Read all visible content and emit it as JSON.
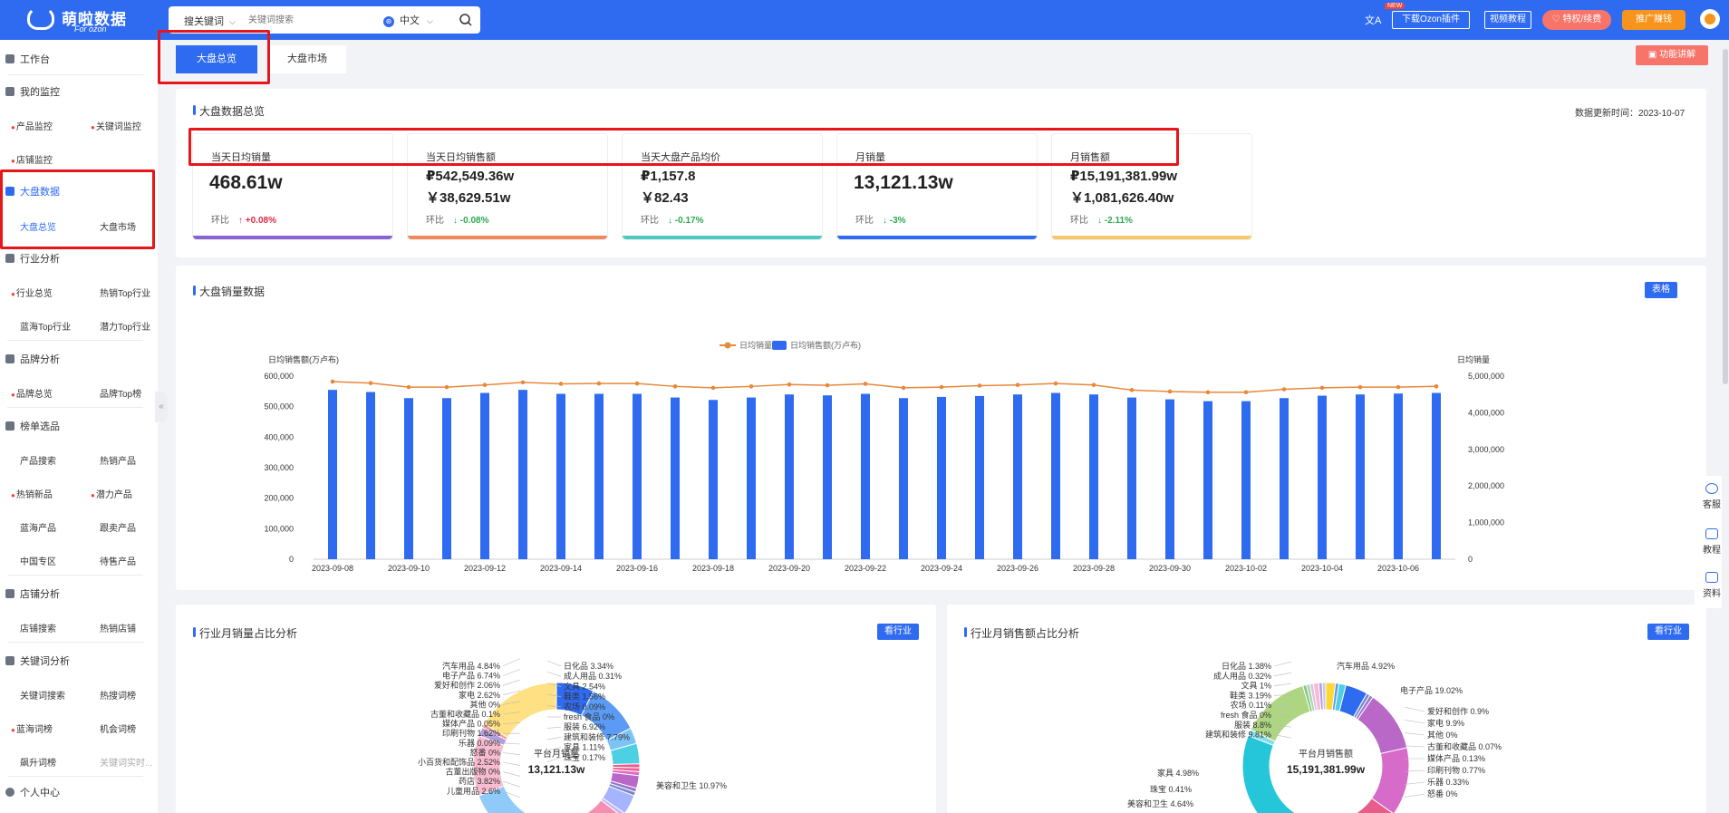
{
  "brand": {
    "name": "萌啦数据",
    "sub": "For ozon"
  },
  "search": {
    "type": "搜关键词",
    "placeholder": "关键词搜索",
    "lang": "中文"
  },
  "header": {
    "translate": "文A",
    "new_tag": "NEW",
    "download": "下载Ozon插件",
    "video": "视频教程",
    "vip": "特权/续费",
    "promo": "推广赚钱"
  },
  "sidebar": {
    "workbench": "工作台",
    "monitor": "我的监控",
    "monitor_items": [
      "产品监控",
      "关键词监控",
      "店铺监控"
    ],
    "market": "大盘数据",
    "market_items": [
      "大盘总览",
      "大盘市场"
    ],
    "industry": "行业分析",
    "industry_items": [
      "行业总览",
      "热销Top行业",
      "蓝海Top行业",
      "潜力Top行业"
    ],
    "brand": "品牌分析",
    "brand_items": [
      "品牌总览",
      "品牌Top榜"
    ],
    "selection": "榜单选品",
    "selection_items": [
      "产品搜索",
      "热销产品",
      "热销新品",
      "潜力产品",
      "蓝海产品",
      "跟卖产品",
      "中国专区",
      "待售产品"
    ],
    "shop": "店铺分析",
    "shop_items": [
      "店铺搜索",
      "热销店铺"
    ],
    "keyword": "关键词分析",
    "keyword_items": [
      "关键词搜索",
      "热搜词榜",
      "蓝海词榜",
      "机会词榜",
      "飙升词榜",
      "关键词实时..."
    ],
    "personal": "个人中心"
  },
  "tabs": [
    "大盘总览",
    "大盘市场"
  ],
  "feature_btn": "功能讲解",
  "overview": {
    "title": "大盘数据总览",
    "updated": "数据更新时间：2023-10-07",
    "cards": [
      {
        "label": "当天日均销量",
        "value": "468.61w",
        "cmp": "环比",
        "change": "↑ +0.08%",
        "dir": "up",
        "color": "#8a63d2"
      },
      {
        "label": "当天日均销售额",
        "v1": "₽542,549.36w",
        "v2": "￥38,629.51w",
        "cmp": "环比",
        "change": "↓ -0.08%",
        "dir": "down",
        "color": "#f08a5d"
      },
      {
        "label": "当天大盘产品均价",
        "v1": "₽1,157.8",
        "v2": "￥82.43",
        "cmp": "环比",
        "change": "↓ -0.17%",
        "dir": "down",
        "color": "#4cc9c0"
      },
      {
        "label": "月销量",
        "value": "13,121.13w",
        "cmp": "环比",
        "change": "↓ -3%",
        "dir": "down",
        "color": "#2f6bf0"
      },
      {
        "label": "月销售额",
        "v1": "₽15,191,381.99w",
        "v2": "￥1,081,626.40w",
        "cmp": "环比",
        "change": "↓ -2.11%",
        "dir": "down",
        "color": "#f5c86b"
      }
    ]
  },
  "sales": {
    "title": "大盘销量数据",
    "table_btn": "表格"
  },
  "chart_data": {
    "type": "bar",
    "legend": [
      "日均销量",
      "日均销售额(万卢布)"
    ],
    "ylabel_left": "日均销售额(万卢布)",
    "ylabel_right": "日均销量",
    "ylim_left": [
      0,
      600000
    ],
    "ylim_right": [
      0,
      5000000
    ],
    "yticks_left": [
      "600,000",
      "500,000",
      "400,000",
      "300,000",
      "200,000",
      "100,000",
      "0"
    ],
    "yticks_right": [
      "5,000,000",
      "4,000,000",
      "3,000,000",
      "2,000,000",
      "1,000,000",
      "0"
    ],
    "x": [
      "2023-09-08",
      "2023-09-09",
      "2023-09-10",
      "2023-09-11",
      "2023-09-12",
      "2023-09-13",
      "2023-09-14",
      "2023-09-15",
      "2023-09-16",
      "2023-09-17",
      "2023-09-18",
      "2023-09-19",
      "2023-09-20",
      "2023-09-21",
      "2023-09-22",
      "2023-09-23",
      "2023-09-24",
      "2023-09-25",
      "2023-09-26",
      "2023-09-27",
      "2023-09-28",
      "2023-09-29",
      "2023-09-30",
      "2023-10-01",
      "2023-10-02",
      "2023-10-03",
      "2023-10-04",
      "2023-10-05",
      "2023-10-06",
      "2023-10-07"
    ],
    "xticks_shown": [
      "2023-09-08",
      "2023-09-10",
      "2023-09-12",
      "2023-09-14",
      "2023-09-16",
      "2023-09-18",
      "2023-09-20",
      "2023-09-22",
      "2023-09-24",
      "2023-09-26",
      "2023-09-28",
      "2023-09-30",
      "2023-10-02",
      "2023-10-04",
      "2023-10-06"
    ],
    "bars": [
      555000,
      548000,
      528000,
      528000,
      545000,
      555000,
      542000,
      542000,
      542000,
      530000,
      522000,
      530000,
      540000,
      537000,
      542000,
      528000,
      532000,
      535000,
      540000,
      545000,
      540000,
      530000,
      524000,
      518000,
      518000,
      528000,
      536000,
      540000,
      543000,
      545000
    ],
    "line": [
      4850000,
      4810000,
      4700000,
      4700000,
      4760000,
      4830000,
      4790000,
      4800000,
      4800000,
      4720000,
      4680000,
      4720000,
      4770000,
      4750000,
      4790000,
      4680000,
      4700000,
      4740000,
      4760000,
      4800000,
      4760000,
      4620000,
      4580000,
      4560000,
      4560000,
      4640000,
      4680000,
      4700000,
      4700000,
      4720000
    ]
  },
  "industry_qty": {
    "title": "行业月销量占比分析",
    "btn": "看行业",
    "center_label": "平台月销量",
    "center_value": "13,121.13w",
    "labels": [
      [
        "汽车用品",
        "4.84%"
      ],
      [
        "电子产品",
        "6.74%"
      ],
      [
        "爱好和创作",
        "2.06%"
      ],
      [
        "家电",
        "2.62%"
      ],
      [
        "其他",
        "0%"
      ],
      [
        "古董和收藏品",
        "0.1%"
      ],
      [
        "媒体产品",
        "0.05%"
      ],
      [
        "印刷刊物",
        "1.62%"
      ],
      [
        "乐器",
        "0.09%"
      ],
      [
        "怒番",
        "0%"
      ],
      [
        "小百货和配饰品",
        "2.52%"
      ],
      [
        "古董出版物",
        "0%"
      ],
      [
        "药店",
        "3.82%"
      ],
      [
        "儿童用品",
        "2.6%"
      ],
      [
        "日化品",
        "3.34%"
      ],
      [
        "成人用品",
        "0.31%"
      ],
      [
        "文具",
        "2.54%"
      ],
      [
        "鞋类",
        "1.56%"
      ],
      [
        "农场",
        "0.09%"
      ],
      [
        "fresh 食品",
        "0%"
      ],
      [
        "服装",
        "6.92%"
      ],
      [
        "建筑和装修",
        "7.79%"
      ],
      [
        "家具",
        "1.11%"
      ],
      [
        "珠宝",
        "0.17%"
      ],
      [
        "美容和卫生",
        "10.97%"
      ]
    ]
  },
  "industry_amt": {
    "title": "行业月销售额占比分析",
    "btn": "看行业",
    "center_label": "平台月销售额",
    "center_value": "15,191,381.99w",
    "labels": [
      [
        "日化品",
        "1.38%"
      ],
      [
        "成人用品",
        "0.32%"
      ],
      [
        "文具",
        "1%"
      ],
      [
        "鞋类",
        "3.19%"
      ],
      [
        "农场",
        "0.11%"
      ],
      [
        "fresh 食品",
        "0%"
      ],
      [
        "服装",
        "8.8%"
      ],
      [
        "建筑和装修",
        "9.81%"
      ],
      [
        "家具",
        "4.98%"
      ],
      [
        "珠宝",
        "0.41%"
      ],
      [
        "美容和卫生",
        "4.64%"
      ],
      [
        "汽车用品",
        "4.92%"
      ],
      [
        "电子产品",
        "19.02%"
      ],
      [
        "爱好和创作",
        "0.9%"
      ],
      [
        "家电",
        "9.9%"
      ],
      [
        "其他",
        "0%"
      ],
      [
        "古董和收藏品",
        "0.07%"
      ],
      [
        "媒体产品",
        "0.13%"
      ],
      [
        "印刷刊物",
        "0.77%"
      ],
      [
        "乐器",
        "0.33%"
      ],
      [
        "怒番",
        "0%"
      ]
    ]
  },
  "right_tools": [
    "客服",
    "教程",
    "资料"
  ],
  "colors": {
    "primary": "#2f6bf0",
    "line": "#e8883a",
    "up": "#e0284a",
    "down": "#2bab4f"
  }
}
